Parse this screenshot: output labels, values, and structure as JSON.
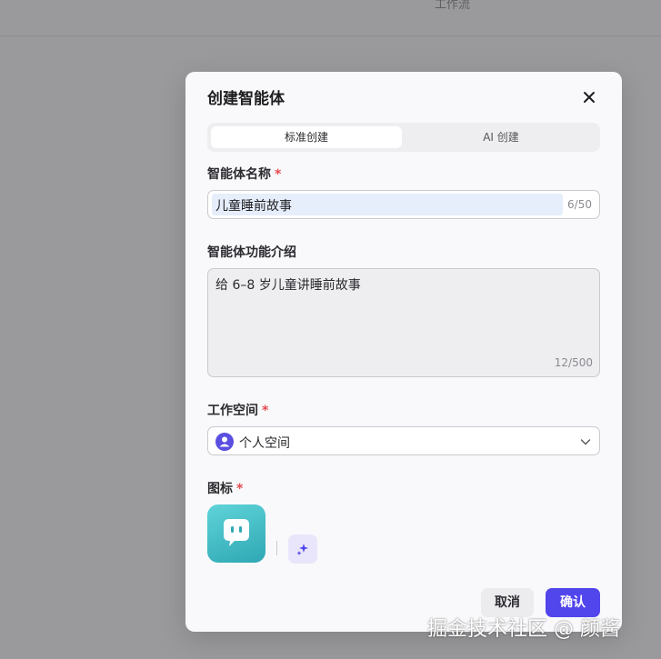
{
  "background": {
    "tab_label": "工作流"
  },
  "modal": {
    "title": "创建智能体",
    "tabs": [
      {
        "label": "标准创建",
        "active": true
      },
      {
        "label": "AI 创建",
        "active": false
      }
    ],
    "name_field": {
      "label": "智能体名称",
      "required_mark": "*",
      "value": "儿童睡前故事",
      "counter": "6/50"
    },
    "description_field": {
      "label": "智能体功能介绍",
      "value": "给 6–8 岁儿童讲睡前故事",
      "counter": "12/500"
    },
    "workspace_field": {
      "label": "工作空间",
      "required_mark": "*",
      "selected": "个人空间"
    },
    "icon_field": {
      "label": "图标",
      "required_mark": "*"
    },
    "buttons": {
      "cancel": "取消",
      "confirm": "确认"
    }
  },
  "watermark": "掘金技术社区 @ 颜酱",
  "colors": {
    "accent": "#5145ec",
    "required": "#e5484d",
    "icon_gradient_top": "#5fd3d8",
    "icon_gradient_bottom": "#2fa8b4"
  }
}
